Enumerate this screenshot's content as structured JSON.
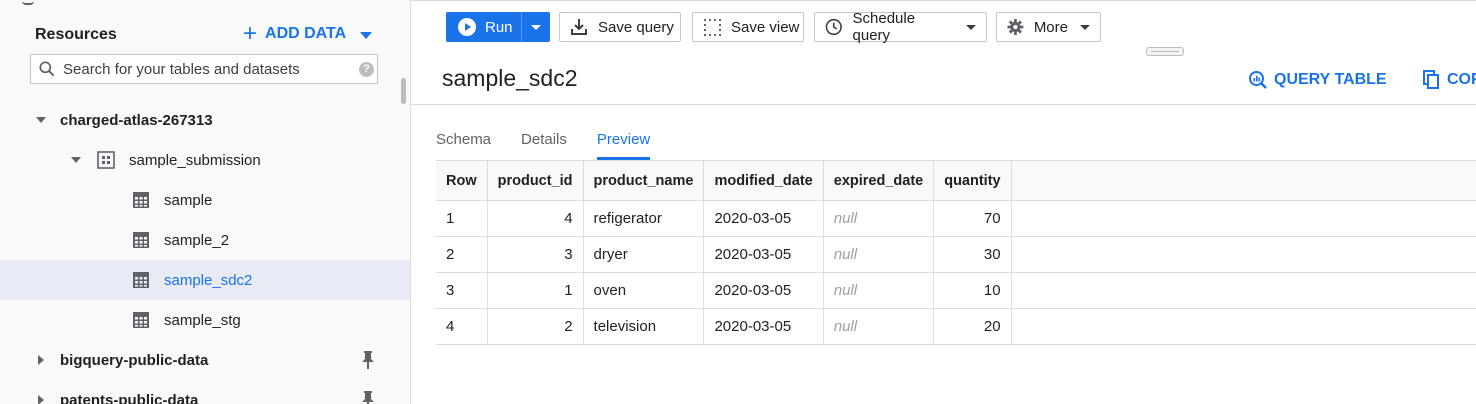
{
  "sidebar": {
    "title": "Resources",
    "add_data": "ADD DATA",
    "search_placeholder": "Search for your tables and datasets",
    "help_icon": "?",
    "tree": [
      {
        "label": "charged-atlas-267313",
        "kind": "project",
        "expanded": true
      },
      {
        "label": "sample_submission",
        "kind": "dataset",
        "expanded": true
      },
      {
        "label": "sample",
        "kind": "table"
      },
      {
        "label": "sample_2",
        "kind": "table"
      },
      {
        "label": "sample_sdc2",
        "kind": "table",
        "selected": true
      },
      {
        "label": "sample_stg",
        "kind": "table"
      },
      {
        "label": "bigquery-public-data",
        "kind": "project",
        "pinned": true
      },
      {
        "label": "patents-public-data",
        "kind": "project",
        "pinned": true
      }
    ]
  },
  "toolbar": {
    "run": "Run",
    "save_query": "Save query",
    "save_view": "Save view",
    "schedule_query": "Schedule query",
    "more": "More"
  },
  "detail": {
    "title": "sample_sdc2",
    "query_table": "QUERY TABLE",
    "copy": "COP"
  },
  "tabs": [
    "Schema",
    "Details",
    "Preview"
  ],
  "active_tab": "Preview",
  "preview": {
    "columns": [
      "Row",
      "product_id",
      "product_name",
      "modified_date",
      "expired_date",
      "quantity"
    ],
    "rows": [
      [
        "1",
        "4",
        "refigerator",
        "2020-03-05",
        "null",
        "70"
      ],
      [
        "2",
        "3",
        "dryer",
        "2020-03-05",
        "null",
        "30"
      ],
      [
        "3",
        "1",
        "oven",
        "2020-03-05",
        "null",
        "10"
      ],
      [
        "4",
        "2",
        "television",
        "2020-03-05",
        "null",
        "20"
      ]
    ]
  },
  "colors": {
    "accent": "#1a73e8",
    "selected_bg": "#e8eaf6",
    "null_text": "#9aa0a6"
  }
}
